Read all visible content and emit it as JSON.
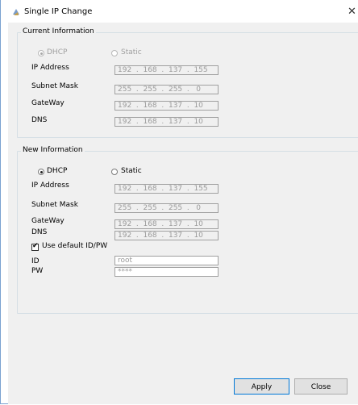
{
  "window": {
    "title": "Single IP Change",
    "close_glyph": "✕"
  },
  "current": {
    "legend": "Current Information",
    "dhcp_label": "DHCP",
    "static_label": "Static",
    "ip_label": "IP Address",
    "subnet_label": "Subnet Mask",
    "gateway_label": "GateWay",
    "dns_label": "DNS",
    "ip": "192  .  168  .  137  .  155",
    "subnet": "255  .  255  .  255  .   0",
    "gateway": "192  .  168  .  137  .  10",
    "dns": "192  .  168  .  137  .  10"
  },
  "new": {
    "legend": "New Information",
    "dhcp_label": "DHCP",
    "static_label": "Static",
    "ip_label": "IP Address",
    "subnet_label": "Subnet Mask",
    "gateway_label": "GateWay",
    "dns_label": "DNS",
    "ip": "192  .  168  .  137  .  155",
    "subnet": "255  .  255  .  255  .   0",
    "gateway": "192  .  168  .  137  .  10",
    "dns": "192  .  168  .  137  .  10",
    "use_default_label": "Use default ID/PW",
    "id_label": "ID",
    "pw_label": "PW",
    "id_value": "root",
    "pw_value": "****"
  },
  "buttons": {
    "apply": "Apply",
    "close": "Close"
  },
  "colors": {
    "border_accent": "#7aa2d0",
    "client_bg": "#f0f0f0",
    "primary_border": "#0078d7"
  }
}
